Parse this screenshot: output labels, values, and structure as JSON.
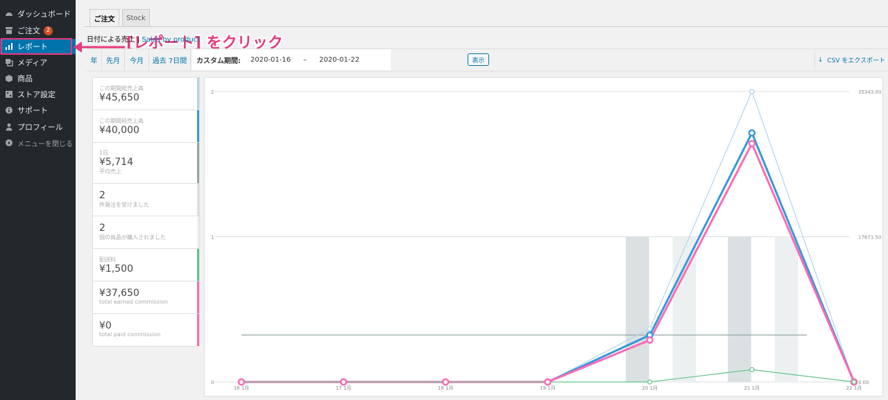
{
  "sidebar": {
    "items": [
      {
        "label": "ダッシュボード",
        "icon": "dashboard-icon"
      },
      {
        "label": "ご注文",
        "icon": "store-icon",
        "badge": "2"
      },
      {
        "label": "レポート",
        "icon": "chart-bar-icon",
        "active": true
      },
      {
        "label": "メディア",
        "icon": "media-icon"
      },
      {
        "label": "商品",
        "icon": "box-icon"
      },
      {
        "label": "ストア設定",
        "icon": "settings-icon"
      },
      {
        "label": "サポート",
        "icon": "info-icon"
      },
      {
        "label": "プロフィール",
        "icon": "user-icon"
      }
    ],
    "collapse_label": "メニューを閉じる"
  },
  "annotation": {
    "text": "[レポート] をクリック",
    "color": "#e8397d"
  },
  "tabs": [
    {
      "label": "ご注文",
      "active": true
    },
    {
      "label": "Stock",
      "active": false
    }
  ],
  "subnav": {
    "prefix": "日付による売上",
    "link": "Sales by product"
  },
  "range": {
    "links": [
      "年",
      "先月",
      "今月",
      "過去 7日間"
    ],
    "custom_label": "カスタム期間:",
    "start_date": "2020-01-16",
    "separator": "–",
    "end_date": "2020-01-22",
    "show_button": "表示",
    "export_label": "CSV をエクスポート"
  },
  "stats": [
    {
      "label": "この期間総売上高",
      "value": "¥45,650",
      "sub": "",
      "color": "#b1d4ea"
    },
    {
      "label": "この期間純売上高",
      "value": "¥40,000",
      "sub": "",
      "color": "#3498db"
    },
    {
      "label": "1日",
      "value": "¥5,714",
      "sub": "平均売上",
      "color": "#95a5a6"
    },
    {
      "label": "",
      "value": "2",
      "sub": "件発注を受けました",
      "color": "#dbe1e3"
    },
    {
      "label": "",
      "value": "2",
      "sub": "個の商品が購入されました",
      "color": "#ecf0f1"
    },
    {
      "label": "配送料",
      "value": "¥1,500",
      "sub": "",
      "color": "#5cc488"
    },
    {
      "label": "",
      "value": "¥37,650",
      "sub": "total earned commission",
      "color": "#ff69b4"
    },
    {
      "label": "",
      "value": "¥0",
      "sub": "total paid commission",
      "color": "#ff69b4"
    }
  ],
  "chart_data": {
    "type": "line",
    "categories": [
      "16 1月",
      "17 1月",
      "18 1月",
      "19 1月",
      "20 1月",
      "21 1月",
      "22 1月"
    ],
    "left_axis": {
      "ticks": [
        "0",
        "1",
        "2"
      ],
      "range": [
        0,
        2
      ]
    },
    "right_axis": {
      "ticks": [
        "0.00",
        "17671.50",
        "35343.00"
      ],
      "range": [
        0,
        35343
      ]
    },
    "bars": [
      {
        "name": "orders",
        "values": [
          0,
          0,
          0,
          0,
          1,
          1,
          0
        ],
        "color": "#dbe1e3"
      },
      {
        "name": "items",
        "values": [
          0,
          0,
          0,
          0,
          1,
          1,
          0
        ],
        "color": "#ecf0f1"
      }
    ],
    "series": [
      {
        "name": "gross",
        "values": [
          0,
          0,
          0,
          0,
          6500,
          35343,
          0
        ],
        "color": "#b1d4ea"
      },
      {
        "name": "net",
        "values": [
          0,
          0,
          0,
          0,
          5700,
          30300,
          0
        ],
        "color": "#3498db"
      },
      {
        "name": "commission",
        "values": [
          0,
          0,
          0,
          0,
          5100,
          29000,
          0
        ],
        "color": "#ff69b4"
      },
      {
        "name": "shipping",
        "values": [
          0,
          0,
          0,
          0,
          0,
          1500,
          0
        ],
        "color": "#5cc488"
      }
    ],
    "average": {
      "value": 5714,
      "color": "#95a5a6"
    }
  }
}
